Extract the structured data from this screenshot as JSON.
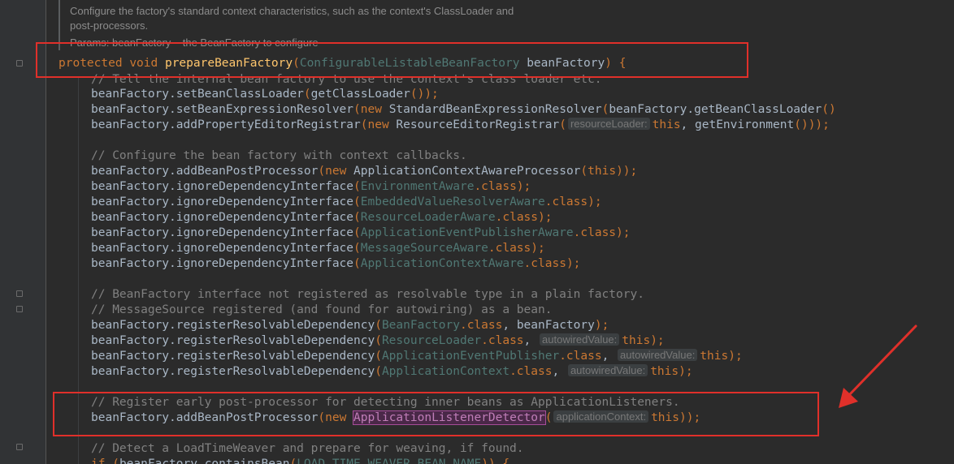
{
  "javadoc": {
    "line1": "Configure the factory's standard context characteristics, such as the context's ClassLoader and",
    "line2": "post-processors.",
    "line3": "Params: beanFactory – the BeanFactory to configure"
  },
  "method": {
    "modifier1": "protected",
    "modifier2": "void",
    "name": "prepareBeanFactory",
    "param_type": "ConfigurableListableBeanFactory",
    "param_name": "beanFactory"
  },
  "lines": {
    "c1": "// Tell the internal bean factory to use the context's class loader etc.",
    "l1_recv": "beanFactory.",
    "l1_m": "setBeanClassLoader",
    "l1_arg": "getClassLoader",
    "l2_recv": "beanFactory.",
    "l2_m": "setBeanExpressionResolver",
    "l2_cls": "StandardBeanExpressionResolver",
    "l2_arg": "beanFactory.getBeanClassLoader",
    "l3_recv": "beanFactory.",
    "l3_m": "addPropertyEditorRegistrar",
    "l3_cls": "ResourceEditorRegistrar",
    "l3_hint": "resourceLoader:",
    "l3_tail": "this, getEnvironment",
    "c2": "// Configure the bean factory with context callbacks.",
    "l4_m": "addBeanPostProcessor",
    "l4_cls": "ApplicationContextAwareProcessor",
    "ignore_method": "ignoreDependencyInterface",
    "ignore_classes": [
      "EnvironmentAware",
      "EmbeddedValueResolverAware",
      "ResourceLoaderAware",
      "ApplicationEventPublisherAware",
      "MessageSourceAware",
      "ApplicationContextAware"
    ],
    "c3": "// BeanFactory interface not registered as resolvable type in a plain factory.",
    "c4": "// MessageSource registered (and found for autowiring) as a bean.",
    "register_method": "registerResolvableDependency",
    "reg1_cls": "BeanFactory",
    "reg1_tail": "beanFactory",
    "reg2_cls": "ResourceLoader",
    "reg3_cls": "ApplicationEventPublisher",
    "reg4_cls": "ApplicationContext",
    "autowired_hint": "autowiredValue:",
    "c5": "// Register early post-processor for detecting inner beans as ApplicationListeners.",
    "l5_m": "addBeanPostProcessor",
    "l5_cls": "ApplicationListenerDetector",
    "l5_hint": "applicationContext:",
    "c6": "// Detect a LoadTimeWeaver and prepare for weaving, if found.",
    "l6_kw": "if",
    "l6_recv": "beanFactory.",
    "l6_m": "containsBean",
    "l6_arg": "LOAD_TIME_WEAVER_BEAN_NAME"
  },
  "tokens": {
    "new": "new",
    "this": "this",
    "class": ".class",
    "recv": "beanFactory."
  },
  "colors": {
    "keyword": "#cc7832",
    "method_decl": "#ffc66d",
    "comment": "#808080",
    "param_type": "#507874",
    "annotation_red": "#e0302a"
  }
}
